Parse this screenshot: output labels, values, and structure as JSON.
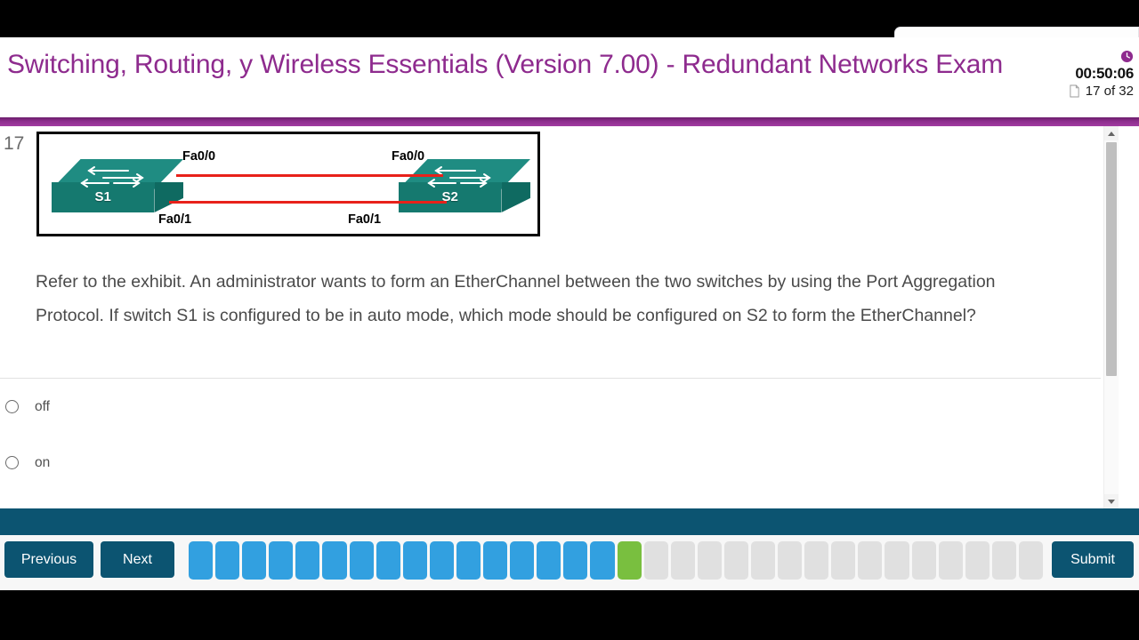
{
  "header": {
    "exam_title": "Switching, Routing, y Wireless Essentials (Version 7.00) - Redundant Networks Exam",
    "title_color": "#8e2b8e",
    "clock_icon": "clock-icon",
    "timer": "00:50:06",
    "page_icon": "document-icon",
    "page_indicator": "17 of 32"
  },
  "question": {
    "number": "17",
    "text": "Refer to the exhibit. An administrator wants to form an EtherChannel between the two switches by using the Port Aggregation Protocol. If switch S1 is configured to be in auto mode, which mode should be configured on S2 to form the EtherChannel?",
    "options": [
      {
        "label": "off",
        "selected": false
      },
      {
        "label": "on",
        "selected": false
      }
    ]
  },
  "exhibit": {
    "alt": "network-topology-two-switches",
    "device_left": "S1",
    "device_right": "S2",
    "interface_top_left": "Fa0/0",
    "interface_top_right": "Fa0/0",
    "interface_bottom_left": "Fa0/1",
    "interface_bottom_right": "Fa0/1",
    "switch_color": "#1f8c82",
    "link_color": "#e8211a"
  },
  "footer": {
    "previous_label": "Previous",
    "next_label": "Next",
    "submit_label": "Submit",
    "accent_color": "#0c5471",
    "answered_color": "#32a0e0",
    "current_color": "#79bf3f",
    "empty_color": "#e0e0e0",
    "total_questions": 32,
    "current_question": 17,
    "answered_through": 16
  }
}
